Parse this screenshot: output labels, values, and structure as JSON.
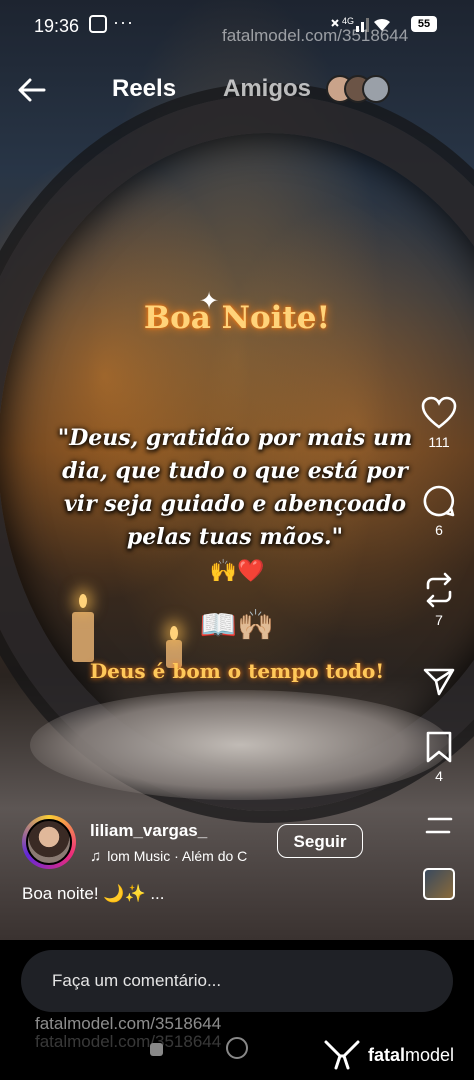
{
  "status_bar": {
    "time": "19:36",
    "more": "···",
    "network": "4G",
    "battery": "55"
  },
  "watermark": {
    "top": "fatalmodel.com/3518644",
    "bottom": "fatalmodel.com/3518644",
    "bottom_ghost": "fatalmodel.com/3518644"
  },
  "nav": {
    "tabs": [
      "Reels",
      "Amigos"
    ],
    "active_tab": "Reels"
  },
  "reel_overlay": {
    "greeting": "Boa Noite!",
    "quote_lines": [
      "\"Deus, gratidão por mais um",
      "dia, que tudo o que está por",
      "vir seja guiado e abençoado",
      "pelas tuas mãos.\""
    ],
    "emoji_row_1": "🙌❤️",
    "emoji_row_2": "📖🙌🏼",
    "tagline": "Deus é bom o tempo todo!"
  },
  "actions": {
    "like_count": "111",
    "comment_count": "6",
    "repost_count": "7",
    "save_count": "4"
  },
  "author": {
    "username": "liliam_vargas_",
    "music": "lom Music · Além do C",
    "follow_label": "Seguir"
  },
  "caption": "Boa noite! 🌙✨ ...",
  "comment": {
    "placeholder": "Faça um comentário..."
  },
  "brand": {
    "name_bold": "fatal",
    "name_light": "model"
  },
  "colors": {
    "greeting": "#ffd37a",
    "tagline": "#ffc85a",
    "comment_bg": "#1f2126"
  }
}
